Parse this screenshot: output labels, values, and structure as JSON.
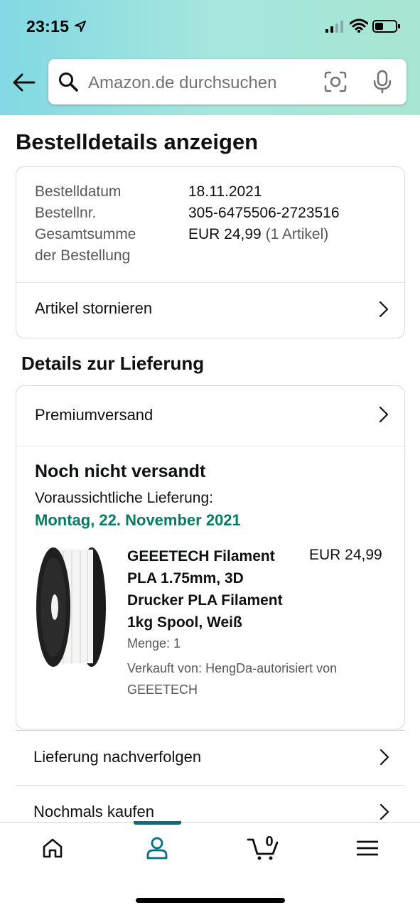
{
  "status_bar": {
    "time": "23:15"
  },
  "search": {
    "placeholder": "Amazon.de durchsuchen"
  },
  "page": {
    "title": "Bestelldetails anzeigen"
  },
  "order_summary": {
    "rows": [
      {
        "label": "Bestelldatum",
        "value": "18.11.2021"
      },
      {
        "label": "Bestellnr.",
        "value": "305-6475506-2723516"
      },
      {
        "label_line1": "Gesamtsumme",
        "label_line2": "der Bestellung",
        "value": "EUR 24,99",
        "value_suffix": "(1 Artikel)"
      }
    ],
    "cancel_label": "Artikel stornieren"
  },
  "delivery": {
    "section_title": "Details zur Lieferung",
    "shipping_method": "Premiumversand",
    "status": "Noch nicht versandt",
    "expected_label": "Voraussichtliche Lieferung:",
    "expected_date": "Montag, 22. November 2021",
    "item": {
      "title_lines": [
        "GEEETECH Filament",
        "PLA 1.75mm, 3D",
        "Drucker PLA Filament",
        "1kg Spool, Weiß"
      ],
      "price": "EUR 24,99",
      "quantity": "Menge: 1",
      "seller_line1": "Verkauft von: HengDa-autorisiert von",
      "seller_line2": "GEEETECH"
    }
  },
  "actions": [
    {
      "label": "Lieferung nachverfolgen"
    },
    {
      "label": "Nochmals kaufen"
    }
  ],
  "bottom_nav": {
    "items": [
      "home-icon",
      "account-icon",
      "cart-icon",
      "menu-icon"
    ],
    "active": "account-icon",
    "cart_count": "0",
    "accent_color": "#007185"
  },
  "colors": {
    "delivery_green": "#067d62",
    "header_gradient_start": "#82d8e3",
    "header_gradient_end": "#a8e5d2"
  }
}
